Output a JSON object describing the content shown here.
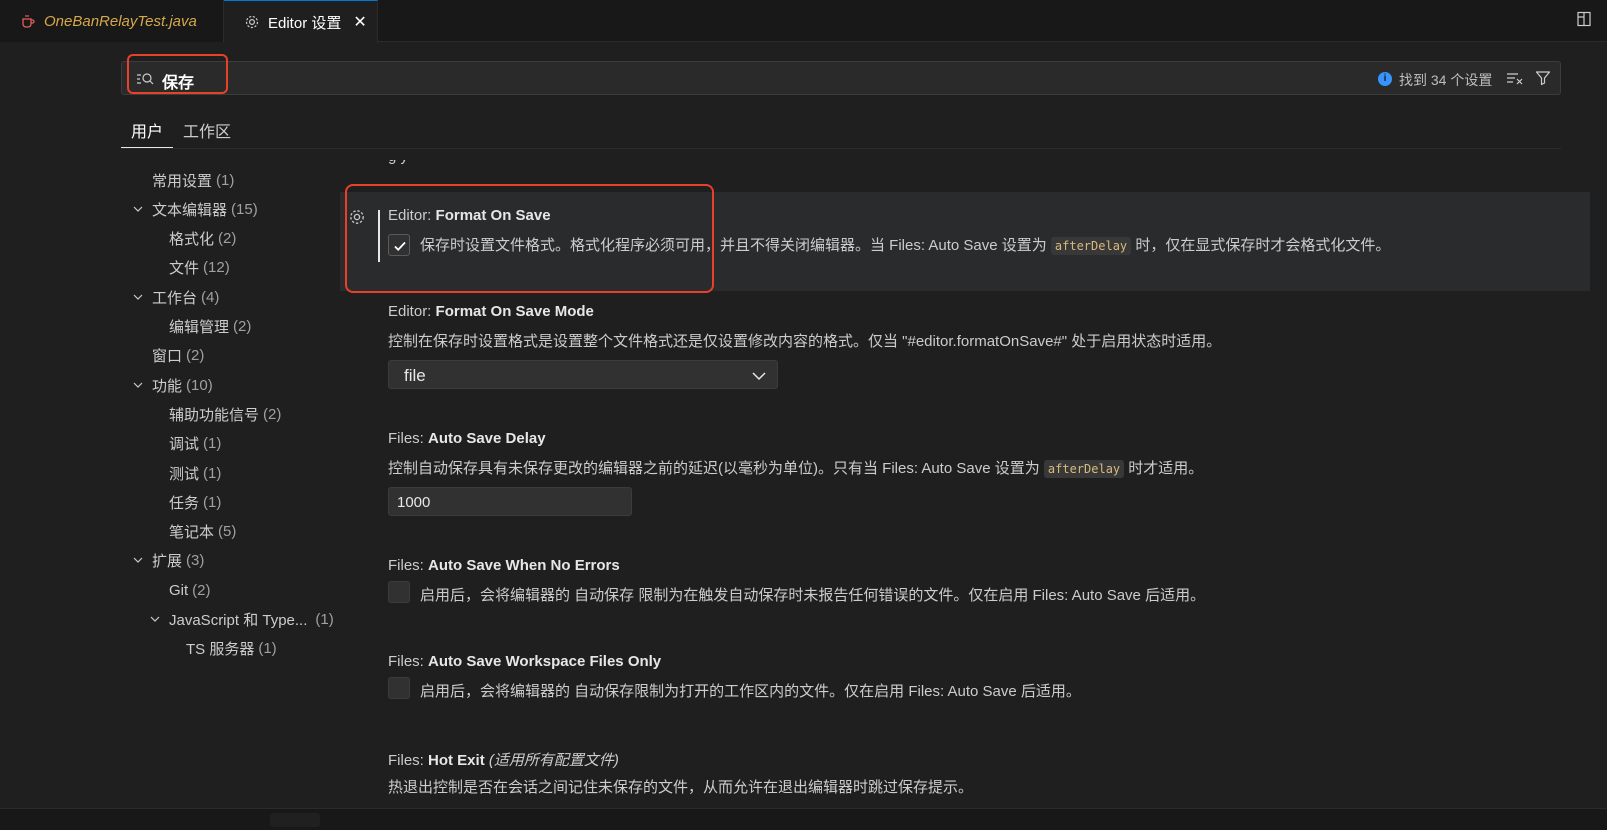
{
  "tabs": [
    {
      "label": "OneBanRelayTest.java"
    },
    {
      "label": "Editor 设置"
    }
  ],
  "search": {
    "query": "保存",
    "result_count": "找到 34 个设置"
  },
  "scope_tabs": {
    "user": "用户",
    "workspace": "工作区"
  },
  "tree": [
    {
      "label": "常用设置",
      "count": "(1)"
    },
    {
      "label": "文本编辑器",
      "count": "(15)"
    },
    {
      "label": "格式化",
      "count": "(2)"
    },
    {
      "label": "文件",
      "count": "(12)"
    },
    {
      "label": "工作台",
      "count": "(4)"
    },
    {
      "label": "编辑管理",
      "count": "(2)"
    },
    {
      "label": "窗口",
      "count": "(2)"
    },
    {
      "label": "功能",
      "count": "(10)"
    },
    {
      "label": "辅助功能信号",
      "count": "(2)"
    },
    {
      "label": "调试",
      "count": "(1)"
    },
    {
      "label": "测试",
      "count": "(1)"
    },
    {
      "label": "任务",
      "count": "(1)"
    },
    {
      "label": "笔记本",
      "count": "(5)"
    },
    {
      "label": "扩展",
      "count": "(3)"
    },
    {
      "label": "Git",
      "count": "(2)"
    },
    {
      "label": "JavaScript 和 Type...",
      "count": "(1)"
    },
    {
      "label": "TS 服务器",
      "count": "(1)"
    }
  ],
  "settings": {
    "clipped": "g y",
    "format_on_save": {
      "category": "Editor: ",
      "name": "Format On Save",
      "checked": true,
      "desc_before": "保存时设置文件格式。格式化程序必须可用，并且不得关闭编辑器。当 Files: Auto Save 设置为 ",
      "code": "afterDelay",
      "desc_after": " 时，仅在显式保存时才会格式化文件。"
    },
    "format_on_save_mode": {
      "category": "Editor: ",
      "name": "Format On Save Mode",
      "desc": "控制在保存时设置格式是设置整个文件格式还是仅设置修改内容的格式。仅当 \"#editor.formatOnSave#\" 处于启用状态时适用。",
      "value": "file"
    },
    "auto_save_delay": {
      "category": "Files: ",
      "name": "Auto Save Delay",
      "desc_before": "控制自动保存具有未保存更改的编辑器之前的延迟(以毫秒为单位)。只有当 Files: Auto Save 设置为 ",
      "code": "afterDelay",
      "desc_after": " 时才适用。",
      "value": "1000"
    },
    "auto_save_no_errors": {
      "category": "Files: ",
      "name": "Auto Save When No Errors",
      "desc": "启用后，会将编辑器的 自动保存 限制为在触发自动保存时未报告任何错误的文件。仅在启用 Files: Auto Save 后适用。"
    },
    "auto_save_workspace": {
      "category": "Files: ",
      "name": "Auto Save Workspace Files Only",
      "desc": "启用后，会将编辑器的 自动保存限制为打开的工作区内的文件。仅在启用 Files: Auto Save 后适用。"
    },
    "hot_exit": {
      "category": "Files: ",
      "name": "Hot Exit",
      "note": "(适用所有配置文件)",
      "desc": "热退出控制是否在会话之间记住未保存的文件，从而允许在退出编辑器时跳过保存提示。"
    }
  },
  "colors": {
    "accent": "#0078d4",
    "highlight_box": "#e8402a",
    "code": "#d7ba7d"
  }
}
